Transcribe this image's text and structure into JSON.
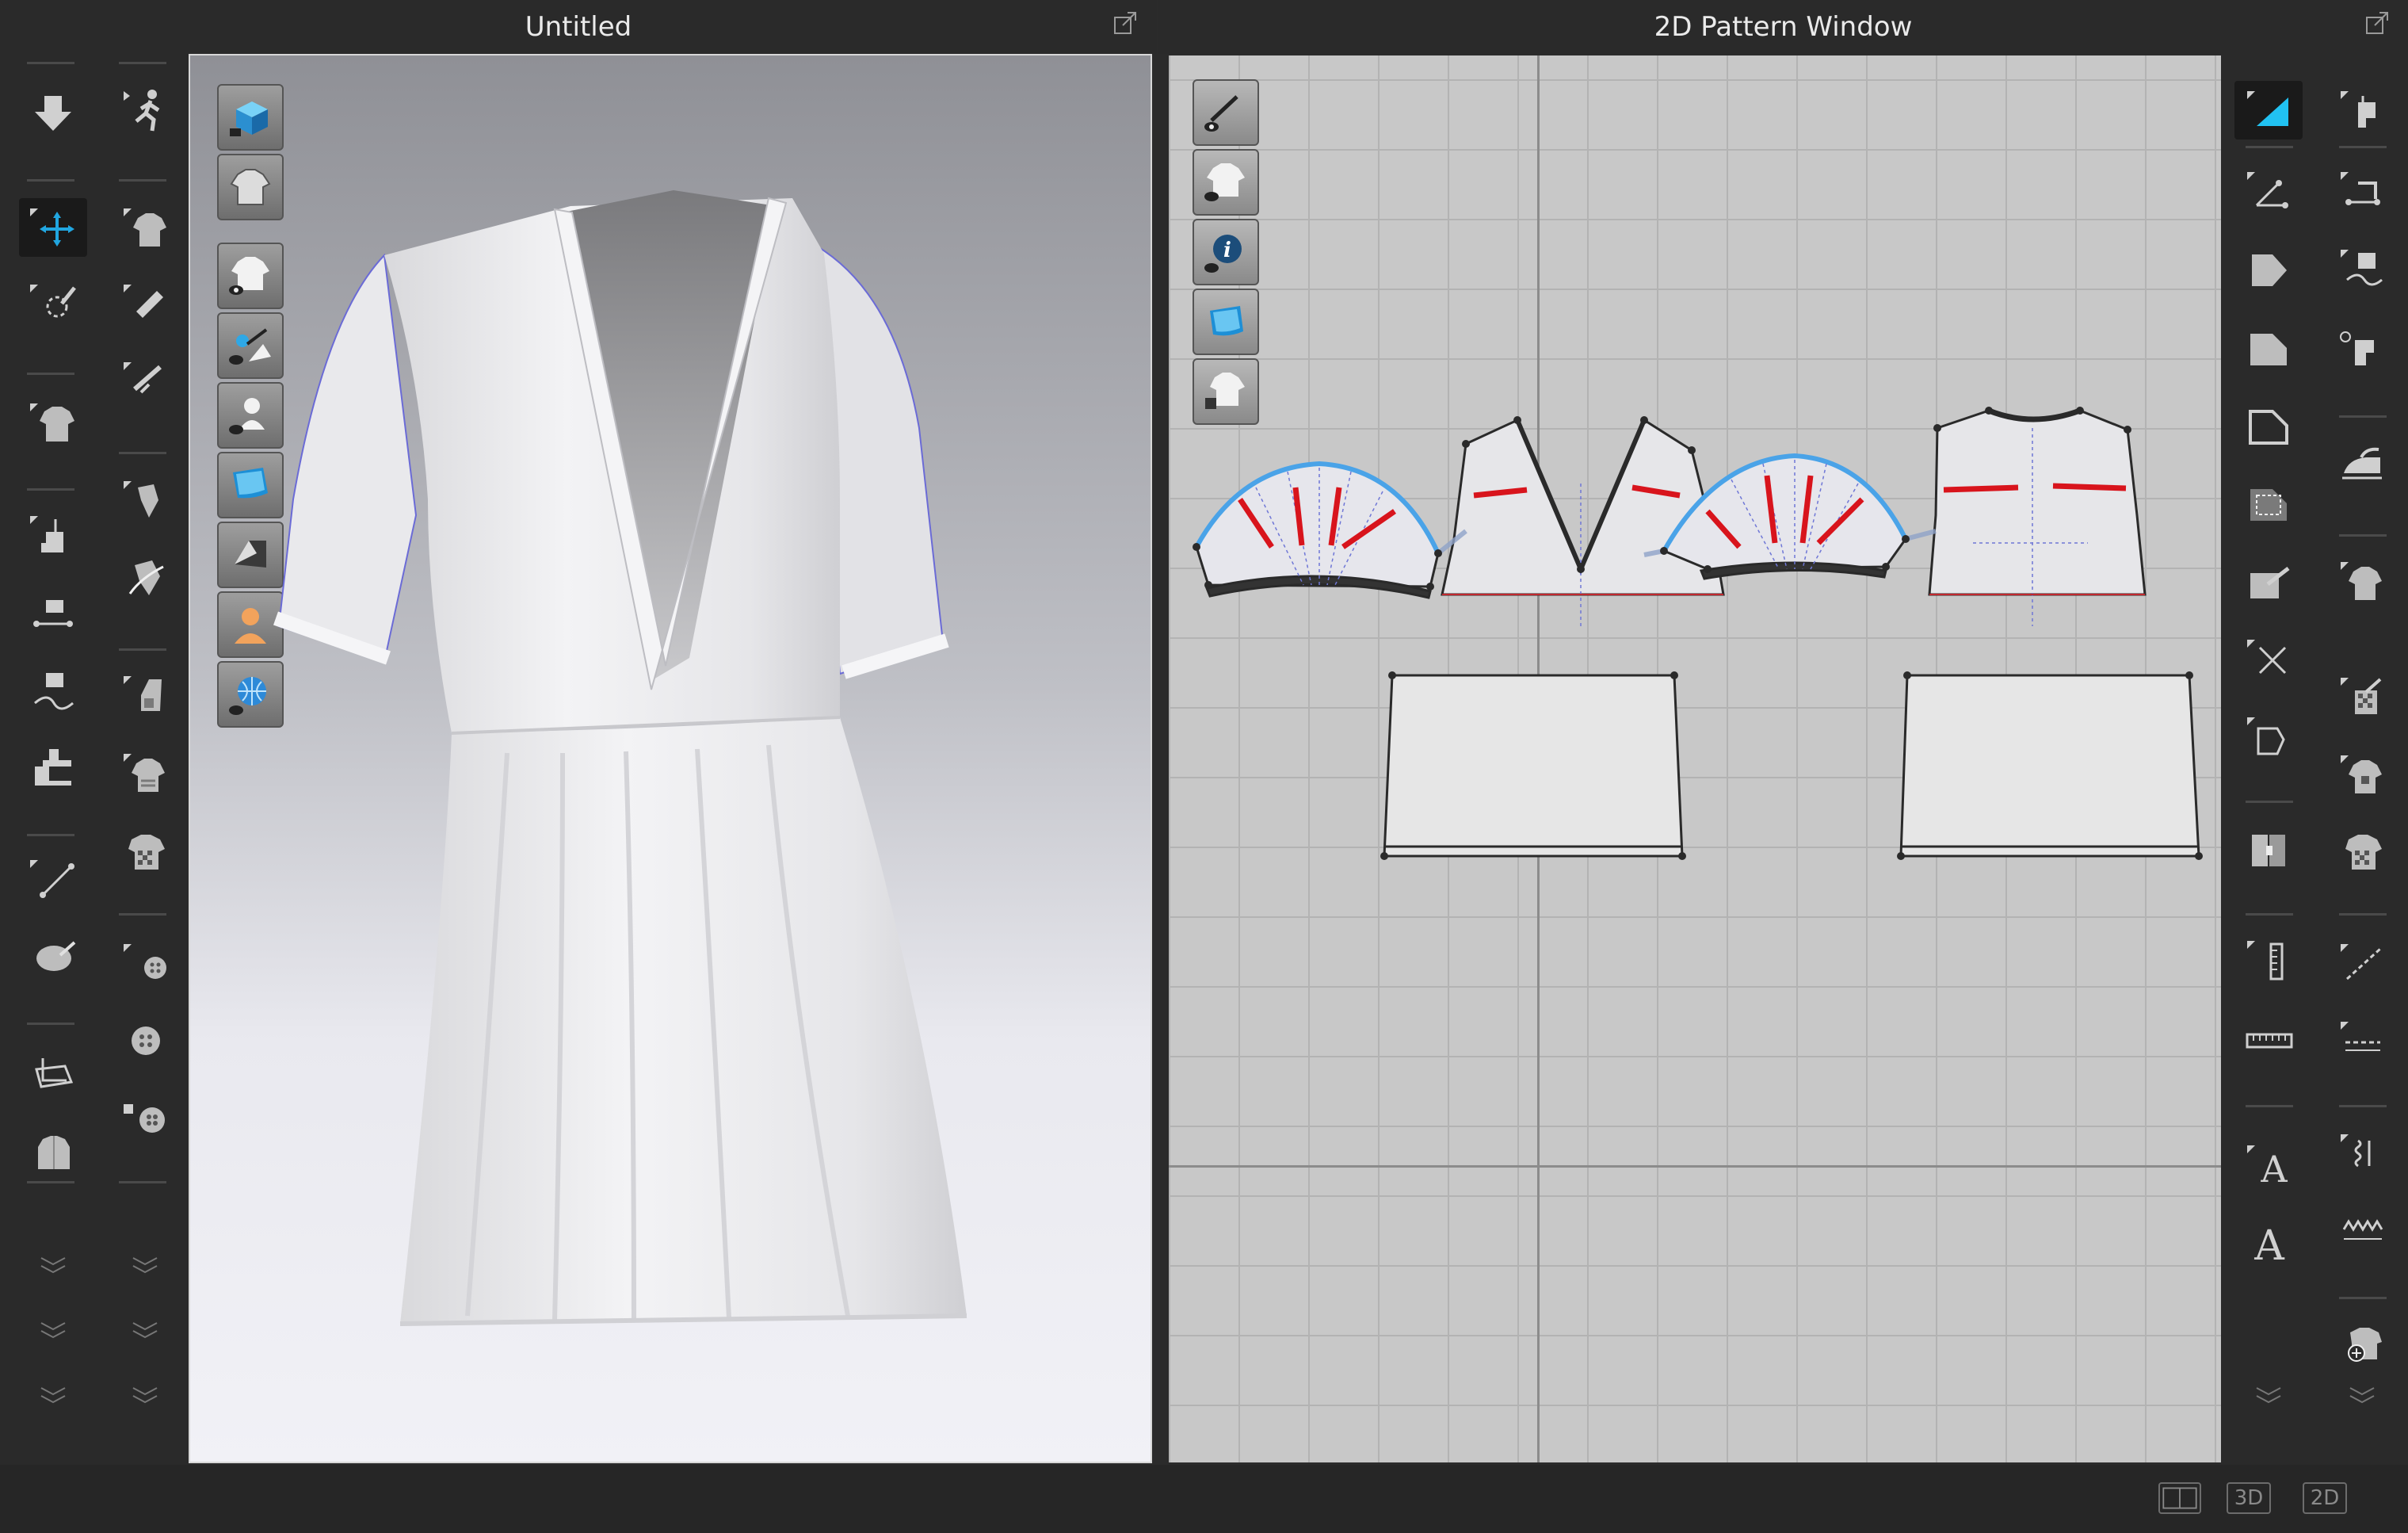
{
  "windows": {
    "left_title": "Untitled",
    "right_title": "2D Pattern Window"
  },
  "status_bar": {
    "mode_3d": "3D",
    "mode_2d": "2D"
  },
  "text_tools": {
    "text_a": "A",
    "text_a2": "A"
  },
  "colors": {
    "accent": "#21a6e0",
    "seam_red": "#d8141c",
    "selection_blue": "#4aa3e8",
    "panel_bg": "#2a2a2a"
  }
}
